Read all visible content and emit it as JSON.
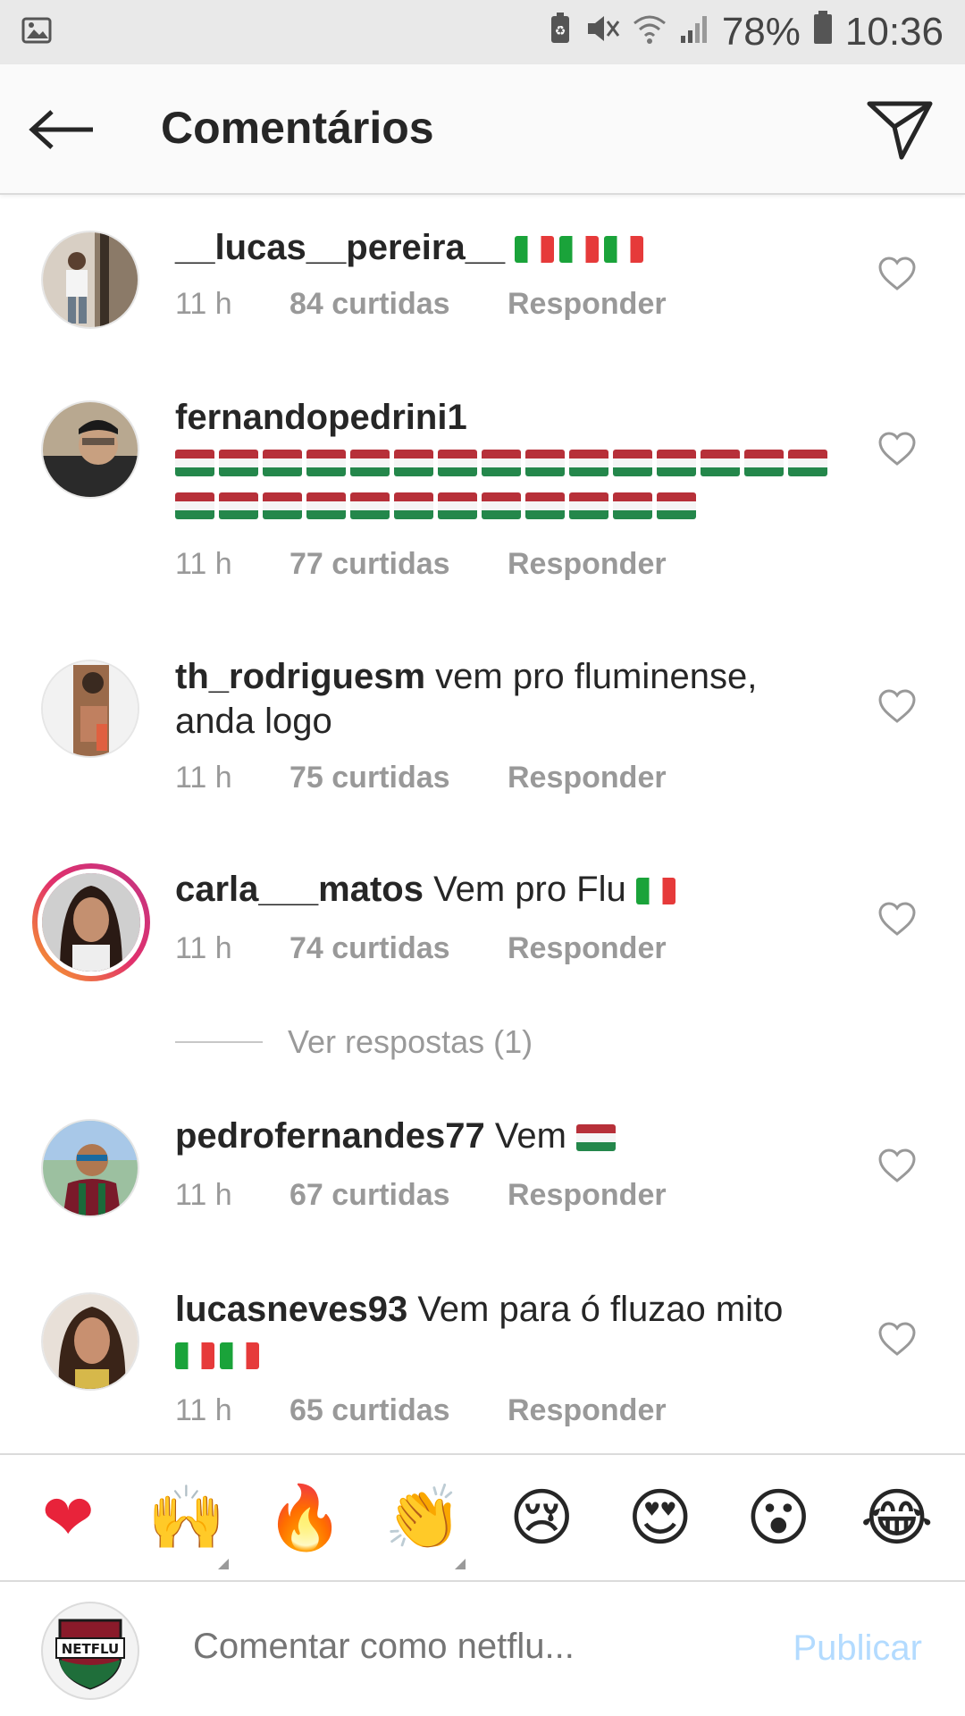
{
  "status_bar": {
    "battery": "78%",
    "time": "10:36"
  },
  "header": {
    "title": "Comentários"
  },
  "comments": [
    {
      "username": "__lucas__pereira__",
      "text": "",
      "flags": "it3",
      "time": "11 h",
      "likes": "84 curtidas",
      "reply": "Responder"
    },
    {
      "username": "fernandopedrini1",
      "text": "",
      "flags": "tri27",
      "time": "11 h",
      "likes": "77 curtidas",
      "reply": "Responder"
    },
    {
      "username": "th_rodriguesm",
      "text": "vem pro fluminense, anda logo",
      "time": "11 h",
      "likes": "75 curtidas",
      "reply": "Responder"
    },
    {
      "username": "carla___matos",
      "text": "Vem pro Flu",
      "flags": "it1",
      "time": "11 h",
      "likes": "74 curtidas",
      "reply": "Responder"
    },
    {
      "username": "pedrofernandes77",
      "text": "Vem",
      "flags": "tri1",
      "time": "11 h",
      "likes": "67 curtidas",
      "reply": "Responder"
    },
    {
      "username": "lucasneves93",
      "text": "Vem para ó fluzao mito",
      "flags": "it2",
      "time": "11 h",
      "likes": "65 curtidas",
      "reply": "Responder"
    }
  ],
  "view_replies": "Ver respostas (1)",
  "emoji_bar": [
    "❤",
    "🙌",
    "🔥",
    "👏",
    "😢",
    "😍",
    "😮",
    "😂"
  ],
  "composer": {
    "placeholder": "Comentar como netflu...",
    "publish_label": "Publicar",
    "avatar_text": "NETFLU"
  },
  "colors": {
    "accent_disabled": "#b3dbff",
    "secondary_text": "#999999",
    "story_ring_start": "#f9a825",
    "story_ring_end": "#c13584"
  }
}
